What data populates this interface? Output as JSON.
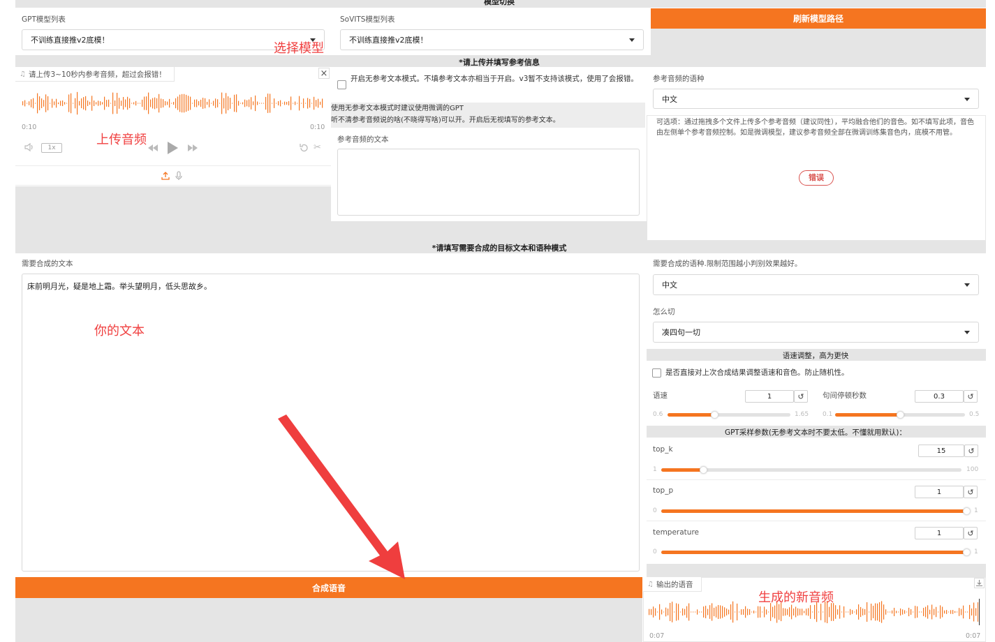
{
  "colors": {
    "accent": "#f57520",
    "annotation": "#f04040",
    "panel_gray": "#e5e5e5"
  },
  "section_model": {
    "title": "模型切换"
  },
  "gpt_model": {
    "label": "GPT模型列表",
    "value": "不训练直接推v2底模！"
  },
  "sovits_model": {
    "label": "SoVITS模型列表",
    "value": "不训练直接推v2底模！"
  },
  "refresh_button": "刷新模型路径",
  "section_reference": {
    "title": "*请上传并填写参考信息"
  },
  "ref_audio": {
    "label": "请上传3~10秒内参考音频，超过会报错！",
    "time_start": "0:10",
    "time_end": "0:10",
    "speed": "1x"
  },
  "no_ref_mode": {
    "checkbox_label": "开启无参考文本模式。不填参考文本亦相当于开启。v3暂不支持该模式，使用了会报错。",
    "hint_line1": "使用无参考文本模式时建议使用微调的GPT",
    "hint_line2": "听不清参考音频说的啥(不晓得写啥)可以开。开启后无视填写的参考文本。"
  },
  "ref_text": {
    "label": "参考音频的文本",
    "value": ""
  },
  "ref_language": {
    "label": "参考音频的语种",
    "value": "中文"
  },
  "multi_ref": {
    "hint": "可选项：通过拖拽多个文件上传多个参考音频（建议同性），平均融合他们的音色。如不填写此项，音色由左侧单个参考音频控制。如是微调模型，建议参考音频全部在微调训练集音色内，底模不用管。",
    "error_badge": "错误"
  },
  "section_target": {
    "title": "*请填写需要合成的目标文本和语种模式"
  },
  "target_text": {
    "label": "需要合成的文本",
    "value": "床前明月光，疑是地上霜。举头望明月，低头思故乡。"
  },
  "target_language": {
    "label": "需要合成的语种.限制范围越小判别效果越好。",
    "value": "中文"
  },
  "split_method": {
    "label": "怎么切",
    "value": "凑四句一切"
  },
  "speed_section": {
    "title": "语速调整，高为更快",
    "checkbox_label": "是否直接对上次合成结果调整语速和音色。防止随机性。"
  },
  "speed_slider": {
    "label": "语速",
    "value": "1",
    "min": "0.6",
    "max": "1.65",
    "fraction": 0.38
  },
  "pause_slider": {
    "label": "句间停顿秒数",
    "value": "0.3",
    "min": "0.1",
    "max": "0.5",
    "fraction": 0.5
  },
  "gpt_params": {
    "title": "GPT采样参数(无参考文本时不要太低。不懂就用默认)："
  },
  "top_k": {
    "label": "top_k",
    "value": "15",
    "min": "1",
    "max": "100",
    "fraction": 0.14
  },
  "top_p": {
    "label": "top_p",
    "value": "1",
    "min": "0",
    "max": "1",
    "fraction": 1.0
  },
  "temperature": {
    "label": "temperature",
    "value": "1",
    "min": "0",
    "max": "1",
    "fraction": 1.0
  },
  "synthesize_button": "合成语音",
  "output_audio": {
    "label": "输出的语音",
    "time_start": "0:07",
    "time_end": "0:07"
  },
  "reset_glyph": "↺",
  "annotations": {
    "select_model": "选择模型",
    "upload_audio": "上传音频",
    "your_text": "你的文本",
    "new_audio": "生成的新音频"
  }
}
